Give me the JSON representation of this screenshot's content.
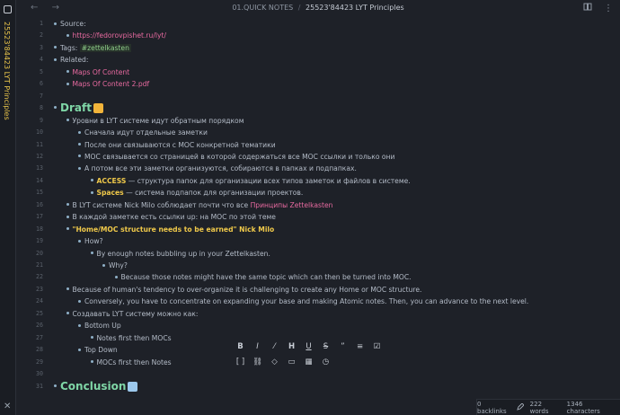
{
  "window": {
    "vertical_title": "25523'84423 LYT Principles",
    "nav_back": "←",
    "nav_forward": "→",
    "breadcrumb_folder": "01.QUICK NOTES",
    "breadcrumb_sep": "/",
    "breadcrumb_file": "25523'84423 LYT Principles",
    "reading_icon": "book-icon",
    "more_icon": "⋮"
  },
  "lines": [
    {
      "n": "1",
      "indent": 0,
      "parts": [
        {
          "t": "Source:"
        }
      ]
    },
    {
      "n": "2",
      "indent": 1,
      "parts": [
        {
          "t": "https://fedorovpishet.ru/lyt/",
          "c": "link"
        }
      ]
    },
    {
      "n": "3",
      "indent": 0,
      "parts": [
        {
          "t": "Tags:  "
        },
        {
          "t": "#zettelkasten",
          "c": "tag"
        }
      ]
    },
    {
      "n": "4",
      "indent": 0,
      "parts": [
        {
          "t": "Related:"
        }
      ]
    },
    {
      "n": "5",
      "indent": 1,
      "parts": [
        {
          "t": "Maps Of Content",
          "c": "link"
        }
      ]
    },
    {
      "n": "6",
      "indent": 1,
      "parts": [
        {
          "t": "Maps Of Content 2.pdf",
          "c": "link"
        }
      ]
    },
    {
      "n": "7",
      "indent": 0,
      "nobullet": true,
      "parts": []
    },
    {
      "n": "8",
      "indent": 0,
      "heading": true,
      "emoji": "#f2b43a",
      "parts": [
        {
          "t": "Draft"
        }
      ]
    },
    {
      "n": "9",
      "indent": 1,
      "parts": [
        {
          "t": "Уровни в LYT системе идут обратным порядком"
        }
      ]
    },
    {
      "n": "10",
      "indent": 2,
      "parts": [
        {
          "t": "Сначала идут отдельные заметки"
        }
      ]
    },
    {
      "n": "11",
      "indent": 2,
      "parts": [
        {
          "t": "После они связываются с MOC конкретной тематики"
        }
      ]
    },
    {
      "n": "12",
      "indent": 2,
      "parts": [
        {
          "t": "MOC связывается со  страницей в которой содержаться все MOC ссылки и только они"
        }
      ]
    },
    {
      "n": "13",
      "indent": 2,
      "parts": [
        {
          "t": "А потом все эти заметки организуются, собираются в папках и подпапках."
        }
      ]
    },
    {
      "n": "14",
      "indent": 3,
      "parts": [
        {
          "t": "ACCESS",
          "c": "yb"
        },
        {
          "t": " — структура папок для организации всех типов заметок и файлов в системе."
        }
      ]
    },
    {
      "n": "15",
      "indent": 3,
      "parts": [
        {
          "t": "Spaces",
          "c": "yb"
        },
        {
          "t": " — система подпапок для организации проектов."
        }
      ]
    },
    {
      "n": "16",
      "indent": 1,
      "parts": [
        {
          "t": "В LYT системе Nick Milo соблюдает почти что все "
        },
        {
          "t": "Принципы Zettelkasten",
          "c": "link"
        }
      ]
    },
    {
      "n": "17",
      "indent": 1,
      "parts": [
        {
          "t": "В каждой заметке есть ссылки up: на MOC по этой теме"
        }
      ]
    },
    {
      "n": "18",
      "indent": 1,
      "parts": [
        {
          "t": "\"Home/MOC structure needs to be earned\" Nick Milo",
          "c": "yb"
        }
      ]
    },
    {
      "n": "19",
      "indent": 2,
      "parts": [
        {
          "t": "How?"
        }
      ]
    },
    {
      "n": "20",
      "indent": 3,
      "parts": [
        {
          "t": "By enough notes bubbling up in your Zettelkasten."
        }
      ]
    },
    {
      "n": "21",
      "indent": 4,
      "parts": [
        {
          "t": "Why?"
        }
      ]
    },
    {
      "n": "22",
      "indent": 5,
      "parts": [
        {
          "t": "Because those notes might have the same topic which can then be  turned into MOC."
        }
      ]
    },
    {
      "n": "23",
      "indent": 1,
      "parts": [
        {
          "t": "Because of human's tendency to over-organize it is challenging to create any Home or  MOC structure."
        }
      ]
    },
    {
      "n": "24",
      "indent": 2,
      "parts": [
        {
          "t": "Conversely, you have to concentrate on expanding your base and making Atomic notes. Then, you can advance to the next level."
        }
      ]
    },
    {
      "n": "25",
      "indent": 1,
      "parts": [
        {
          "t": "Создавать LYT систему можно как:"
        }
      ]
    },
    {
      "n": "26",
      "indent": 2,
      "parts": [
        {
          "t": "Bottom Up"
        }
      ]
    },
    {
      "n": "27",
      "indent": 3,
      "parts": [
        {
          "t": "Notes first then MOCs"
        }
      ]
    },
    {
      "n": "28",
      "indent": 2,
      "parts": [
        {
          "t": "Top Down"
        }
      ]
    },
    {
      "n": "29",
      "indent": 3,
      "parts": [
        {
          "t": "MOCs first then Notes"
        }
      ]
    },
    {
      "n": "30",
      "indent": 0,
      "nobullet": true,
      "parts": []
    },
    {
      "n": "31",
      "indent": 0,
      "heading": true,
      "emoji": "#9cc8ec",
      "parts": [
        {
          "t": "Conclusion"
        }
      ]
    }
  ],
  "toolbar": {
    "row1": [
      "B",
      "I",
      "⁄",
      "H",
      "U",
      "S",
      "”",
      "≡",
      "☑"
    ],
    "row1_names": [
      "bold-icon",
      "italic-icon",
      "highlight-icon",
      "heading-icon",
      "underline-icon",
      "strikethrough-icon",
      "quote-icon",
      "list-icon",
      "checkbox-icon"
    ],
    "row2": [
      "[ ]",
      "⛓",
      "◇",
      "▭",
      "▦",
      "◷"
    ],
    "row2_names": [
      "brackets-icon",
      "link-icon",
      "tag-icon",
      "embed-icon",
      "calendar-icon",
      "clock-icon"
    ]
  },
  "status": {
    "backlinks": "0 backlinks",
    "edit_icon": "pencil-icon",
    "words": "222 words",
    "characters": "1346 characters"
  }
}
